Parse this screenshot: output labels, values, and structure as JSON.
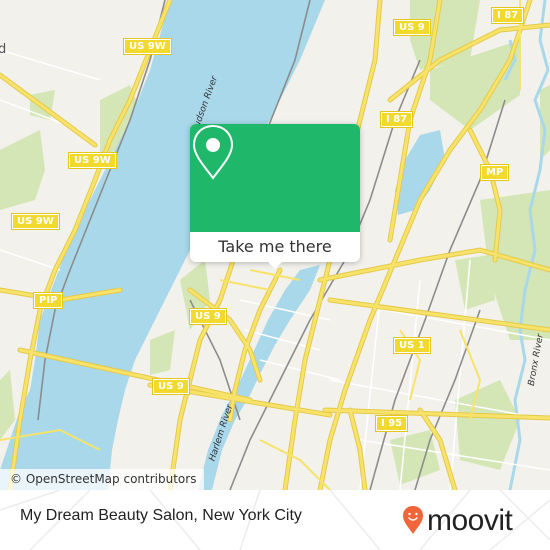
{
  "map": {
    "colors": {
      "land": "#f2f1ec",
      "water": "#a8d8ea",
      "park": "#d4e6b5",
      "road": "#f7e36a",
      "road_edge": "#e5c94a",
      "rail": "#8c8c8c",
      "popup_green": "#1fb86a",
      "brand_orange": "#f0663a"
    },
    "road_shields": [
      {
        "label": "US 9W"
      },
      {
        "label": "US 9W"
      },
      {
        "label": "US 9W"
      },
      {
        "label": "PIP"
      },
      {
        "label": "US 9"
      },
      {
        "label": "US 9"
      },
      {
        "label": "US 9"
      },
      {
        "label": "I 87"
      },
      {
        "label": "I 87"
      },
      {
        "label": "MP"
      },
      {
        "label": "US 1"
      },
      {
        "label": "I 95"
      }
    ],
    "water_labels": [
      {
        "label": "Hudson River"
      },
      {
        "label": "Harlem River"
      },
      {
        "label": "Bronx River"
      }
    ],
    "edge_label": "d",
    "attribution": "© OpenStreetMap contributors"
  },
  "popup": {
    "icon": "map-pin-icon",
    "button_label": "Take me there"
  },
  "footer": {
    "place_name": "My Dream Beauty Salon, New York City",
    "brand": "moovit",
    "brand_icon": "moovit-smiley-pin-icon"
  }
}
